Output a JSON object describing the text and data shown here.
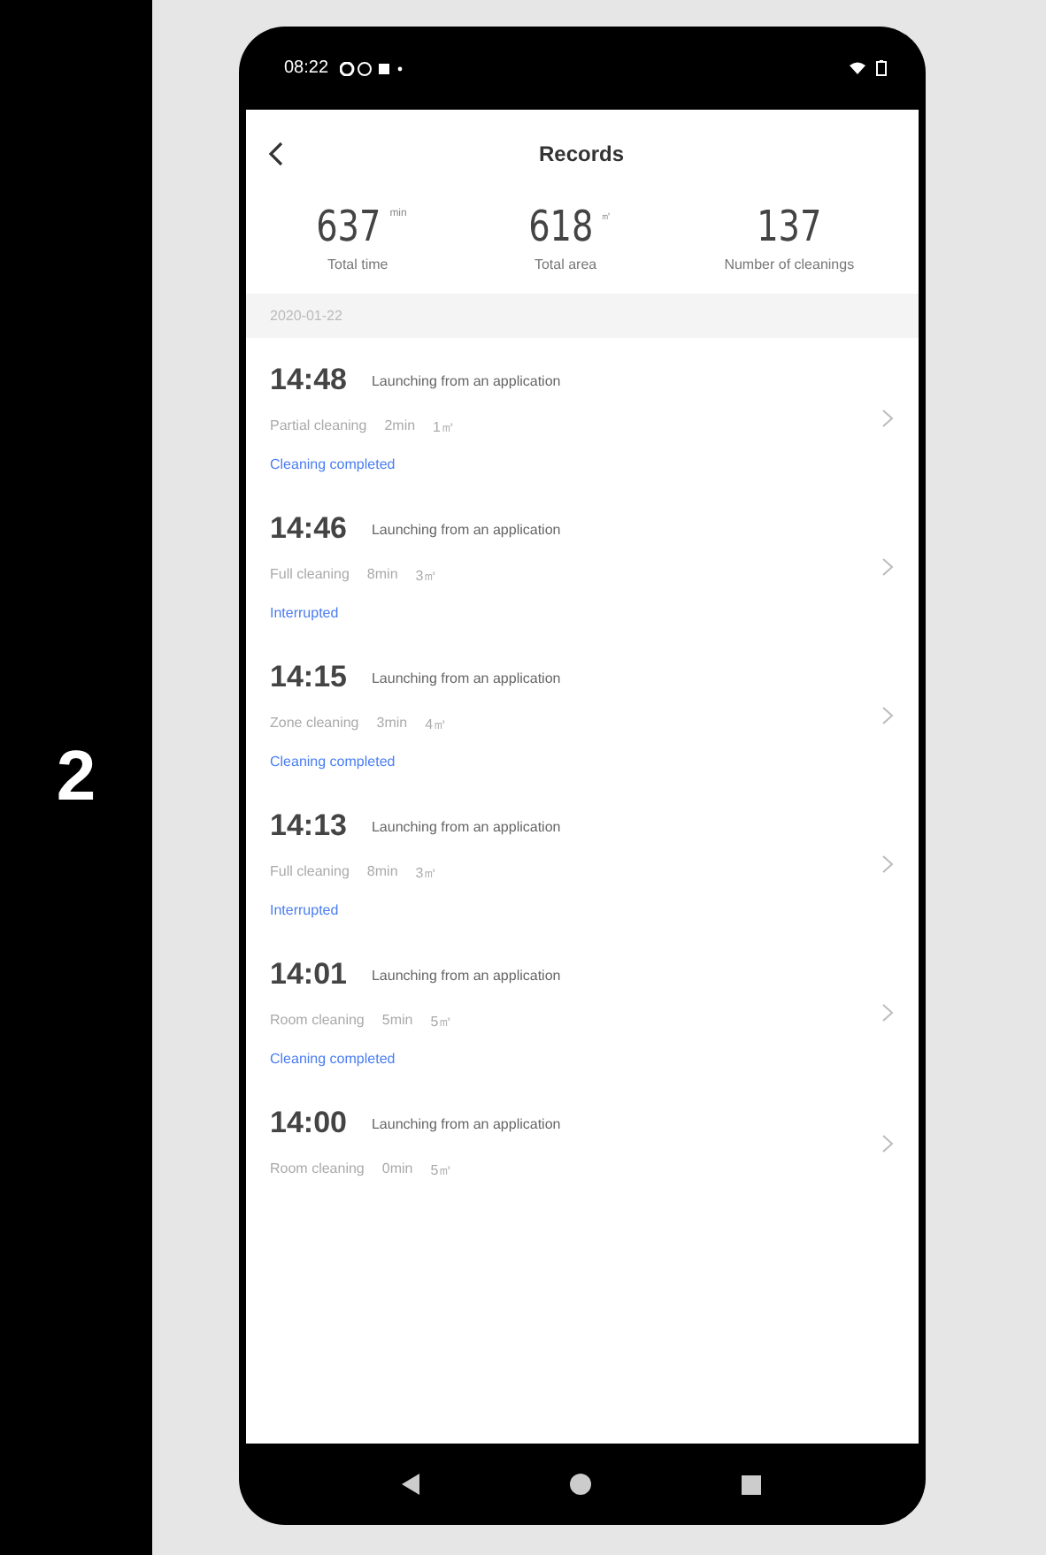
{
  "step": {
    "number": "2"
  },
  "status_bar": {
    "time": "08:22"
  },
  "header": {
    "title": "Records"
  },
  "stats": [
    {
      "value": "637",
      "unit": "min",
      "label": "Total time"
    },
    {
      "value": "618",
      "unit": "㎡",
      "label": "Total area"
    },
    {
      "value": "137",
      "label": "Number of cleanings"
    }
  ],
  "date_header": "2020-01-22",
  "records": [
    {
      "time": "14:48",
      "source": "Launching from an application",
      "mode": "Partial cleaning",
      "duration": "2min",
      "area": "1㎡",
      "result": "Cleaning completed"
    },
    {
      "time": "14:46",
      "source": "Launching from an application",
      "mode": "Full cleaning",
      "duration": "8min",
      "area": "3㎡",
      "result": "Interrupted"
    },
    {
      "time": "14:15",
      "source": "Launching from an application",
      "mode": "Zone cleaning",
      "duration": "3min",
      "area": "4㎡",
      "result": "Cleaning completed"
    },
    {
      "time": "14:13",
      "source": "Launching from an application",
      "mode": "Full cleaning",
      "duration": "8min",
      "area": "3㎡",
      "result": "Interrupted"
    },
    {
      "time": "14:01",
      "source": "Launching from an application",
      "mode": "Room cleaning",
      "duration": "5min",
      "area": "5㎡",
      "result": "Cleaning completed"
    },
    {
      "time": "14:00",
      "source": "Launching from an application",
      "mode": "Room cleaning",
      "duration": "0min",
      "area": "5㎡"
    }
  ]
}
